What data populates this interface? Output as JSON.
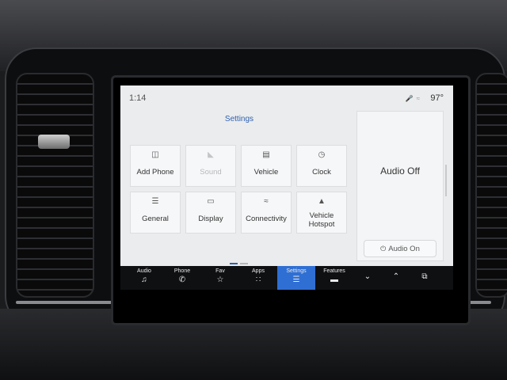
{
  "status": {
    "time": "1:14",
    "temperature": "97°",
    "icons": [
      "mic-muted-icon",
      "wifi-off-icon"
    ]
  },
  "page_title": "Settings",
  "tiles": [
    {
      "label": "Add Phone",
      "icon": "phone-add-icon",
      "enabled": true
    },
    {
      "label": "Sound",
      "icon": "speaker-icon",
      "enabled": false
    },
    {
      "label": "Vehicle",
      "icon": "vehicle-icon",
      "enabled": true
    },
    {
      "label": "Clock",
      "icon": "clock-icon",
      "enabled": true
    },
    {
      "label": "General",
      "icon": "sliders-icon",
      "enabled": true
    },
    {
      "label": "Display",
      "icon": "display-icon",
      "enabled": true
    },
    {
      "label": "Connectivity",
      "icon": "wifi-icon",
      "enabled": true
    },
    {
      "label": "Vehicle Hotspot",
      "icon": "car-wifi-icon",
      "enabled": true
    }
  ],
  "pagination": {
    "pages": 2,
    "current": 1
  },
  "audio_panel": {
    "status": "Audio Off",
    "button_label": "Audio On"
  },
  "nav": [
    {
      "label": "Audio",
      "icon": "music-note-icon"
    },
    {
      "label": "Phone",
      "icon": "phone-icon"
    },
    {
      "label": "Fav",
      "icon": "star-icon"
    },
    {
      "label": "Apps",
      "icon": "grid-icon"
    },
    {
      "label": "Settings",
      "icon": "sliders-icon",
      "active": true
    },
    {
      "label": "Features",
      "icon": "car-icon"
    },
    {
      "label": "",
      "icon": "chevron-down-icon"
    },
    {
      "label": "",
      "icon": "chevron-up-icon"
    },
    {
      "label": "",
      "icon": "copy-icon"
    }
  ],
  "colors": {
    "accent": "#2f6fd4",
    "title": "#2f62b0",
    "screen_bg": "#ebeced",
    "nav_bg": "#0f1012"
  }
}
